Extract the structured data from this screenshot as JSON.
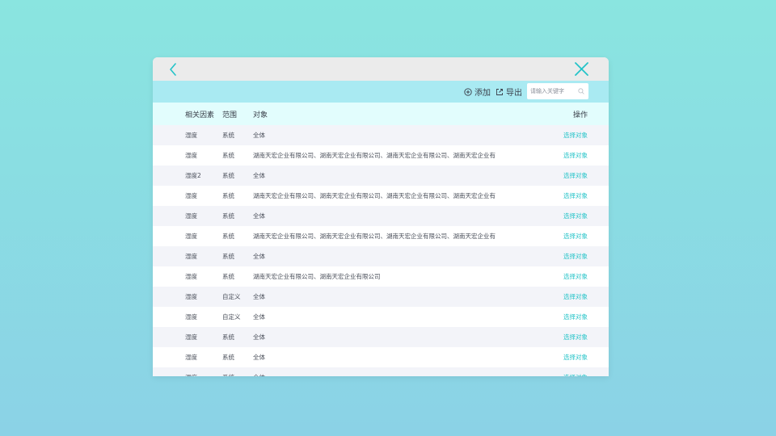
{
  "toolbar": {
    "add_label": "添加",
    "export_label": "导出",
    "search_placeholder": "请输入关键字"
  },
  "table": {
    "headers": {
      "factor": "相关因素",
      "range": "范围",
      "target": "对象",
      "operation": "操作"
    },
    "rows": [
      {
        "factor": "湿度",
        "range": "系统",
        "target": "全体",
        "op": "选择对象"
      },
      {
        "factor": "湿度",
        "range": "系统",
        "target": "湖南天宏企业有限公司、湖南天宏企业有限公司、湖南天宏企业有限公司、湖南天宏企业有限…",
        "op": "选择对象"
      },
      {
        "factor": "湿度2",
        "range": "系统",
        "target": "全体",
        "op": "选择对象"
      },
      {
        "factor": "湿度",
        "range": "系统",
        "target": "湖南天宏企业有限公司、湖南天宏企业有限公司、湖南天宏企业有限公司、湖南天宏企业有限…",
        "op": "选择对象"
      },
      {
        "factor": "湿度",
        "range": "系统",
        "target": "全体",
        "op": "选择对象"
      },
      {
        "factor": "湿度",
        "range": "系统",
        "target": "湖南天宏企业有限公司、湖南天宏企业有限公司、湖南天宏企业有限公司、湖南天宏企业有限…",
        "op": "选择对象"
      },
      {
        "factor": "湿度",
        "range": "系统",
        "target": "全体",
        "op": "选择对象"
      },
      {
        "factor": "湿度",
        "range": "系统",
        "target": "湖南天宏企业有限公司、湖南天宏企业有限公司",
        "op": "选择对象"
      },
      {
        "factor": "湿度",
        "range": "自定义",
        "target": "全体",
        "op": "选择对象"
      },
      {
        "factor": "湿度",
        "range": "自定义",
        "target": "全体",
        "op": "选择对象"
      },
      {
        "factor": "湿度",
        "range": "系统",
        "target": "全体",
        "op": "选择对象"
      },
      {
        "factor": "湿度",
        "range": "系统",
        "target": "全体",
        "op": "选择对象"
      },
      {
        "factor": "湿度",
        "range": "系统",
        "target": "全体",
        "op": "选择对象"
      }
    ]
  },
  "icons": {
    "back": "chevron-left-icon",
    "close": "close-icon",
    "add": "plus-circle-icon",
    "export": "export-icon",
    "search": "search-icon"
  },
  "colors": {
    "accent": "#23c3c8",
    "toolbar_bg": "#a9eaf2",
    "header_bg": "#e2fdfd",
    "titlebar_bg": "#ebebeb"
  }
}
